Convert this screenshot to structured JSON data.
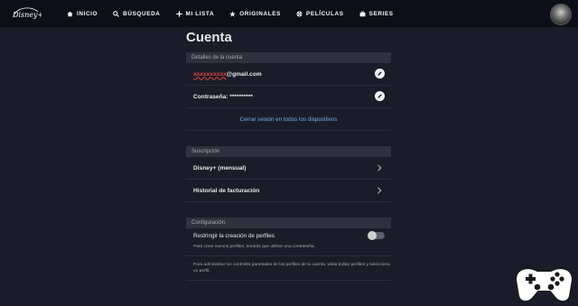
{
  "app": {
    "brand": "Disney+"
  },
  "nav": {
    "items": [
      {
        "label": "INICIO",
        "icon": "home-icon"
      },
      {
        "label": "BÚSQUEDA",
        "icon": "search-icon"
      },
      {
        "label": "MI LISTA",
        "icon": "plus-icon"
      },
      {
        "label": "ORIGINALES",
        "icon": "star-icon"
      },
      {
        "label": "PELÍCULAS",
        "icon": "film-reel-icon"
      },
      {
        "label": "SERIES",
        "icon": "tv-icon"
      }
    ]
  },
  "page": {
    "title": "Cuenta"
  },
  "account": {
    "header": "Detalles de la cuenta",
    "email_prefix": "xxxxxxxxxx",
    "email_domain": "@gmail.com",
    "password": "Contraseña: **********",
    "logout_all": "Cerrar sesión en todos los dispositivos"
  },
  "subscription": {
    "header": "Suscripción",
    "plan": "Disney+ (mensual)",
    "billing": "Historial de facturación"
  },
  "settings": {
    "header": "Configuración",
    "restrict_label": "Restringir la creación de perfiles",
    "restrict_enabled": false,
    "restrict_hint": "Para crear nuevos perfiles, tendrás que utilizar una contraseña.",
    "parental_hint": "Para administrar los controles parentales de los perfiles de tu cuenta, visita Editar perfiles y selecciona un perfil."
  },
  "colors": {
    "background": "#1a1d29",
    "nav": "#0c0f17",
    "link": "#6fb2e8",
    "accent_red": "#e0443c"
  }
}
